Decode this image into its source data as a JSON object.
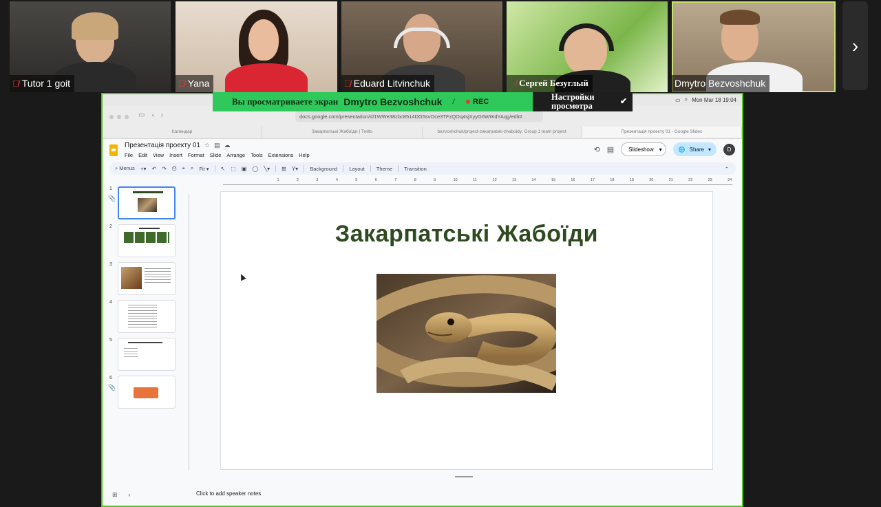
{
  "participants": [
    {
      "name": "Tutor 1 goit",
      "muted": true
    },
    {
      "name": "Yana",
      "muted": true
    },
    {
      "name": "Eduard Litvinchuk",
      "muted": true
    },
    {
      "name": "Сергей Безуглый",
      "muted": true
    },
    {
      "name": "Dmytro Bezvoshchuk",
      "muted": false
    }
  ],
  "next_icon": "chevron-right-icon",
  "share_banner": {
    "viewing_label": "Вы просматриваете экран",
    "presenter": "Dmytro Bezvoshchuk",
    "rec": "REC",
    "settings_label": "Настройки просмотра"
  },
  "mac_bar": {
    "datetime": "Mon Mar 18  19:04"
  },
  "browser": {
    "url": "docs.google.com/presentation/d/1WWe38zbc8514DG5svOce3TFzQOq4sjXyyG6WWdYAqg/edit#",
    "tabs": [
      "Календар",
      "Закарпатські Жабоїди | Trello",
      "bezvoshchuk/project-zakarpatski-zhaboidy: Group 1 team project",
      "Презентація проекту 01 - Google Slides"
    ]
  },
  "docs": {
    "title": "Презентація проекту 01",
    "menus": [
      "File",
      "Edit",
      "View",
      "Insert",
      "Format",
      "Slide",
      "Arrange",
      "Tools",
      "Extensions",
      "Help"
    ],
    "slideshow_label": "Slideshow",
    "share_label": "Share",
    "avatar_initial": "D"
  },
  "toolbar": {
    "menus_label": "Menus",
    "fit_label": "Fit",
    "background": "Background",
    "layout": "Layout",
    "theme": "Theme",
    "transition": "Transition"
  },
  "slides": [
    {
      "num": "1"
    },
    {
      "num": "2"
    },
    {
      "num": "3"
    },
    {
      "num": "4"
    },
    {
      "num": "5"
    },
    {
      "num": "6"
    }
  ],
  "ruler_ticks": [
    "1",
    "2",
    "3",
    "4",
    "5",
    "6",
    "7",
    "8",
    "9",
    "10",
    "11",
    "12",
    "13",
    "14",
    "15",
    "16",
    "17",
    "18",
    "19",
    "20",
    "21",
    "22",
    "23",
    "24",
    "25"
  ],
  "current_slide": {
    "title": "Закарпатські Жабоїди"
  },
  "speaker_notes_placeholder": "Click to add speaker notes",
  "colors": {
    "accent_green": "#52c41a",
    "banner_green": "#2fc85a",
    "title_green": "#2e4a1f"
  }
}
